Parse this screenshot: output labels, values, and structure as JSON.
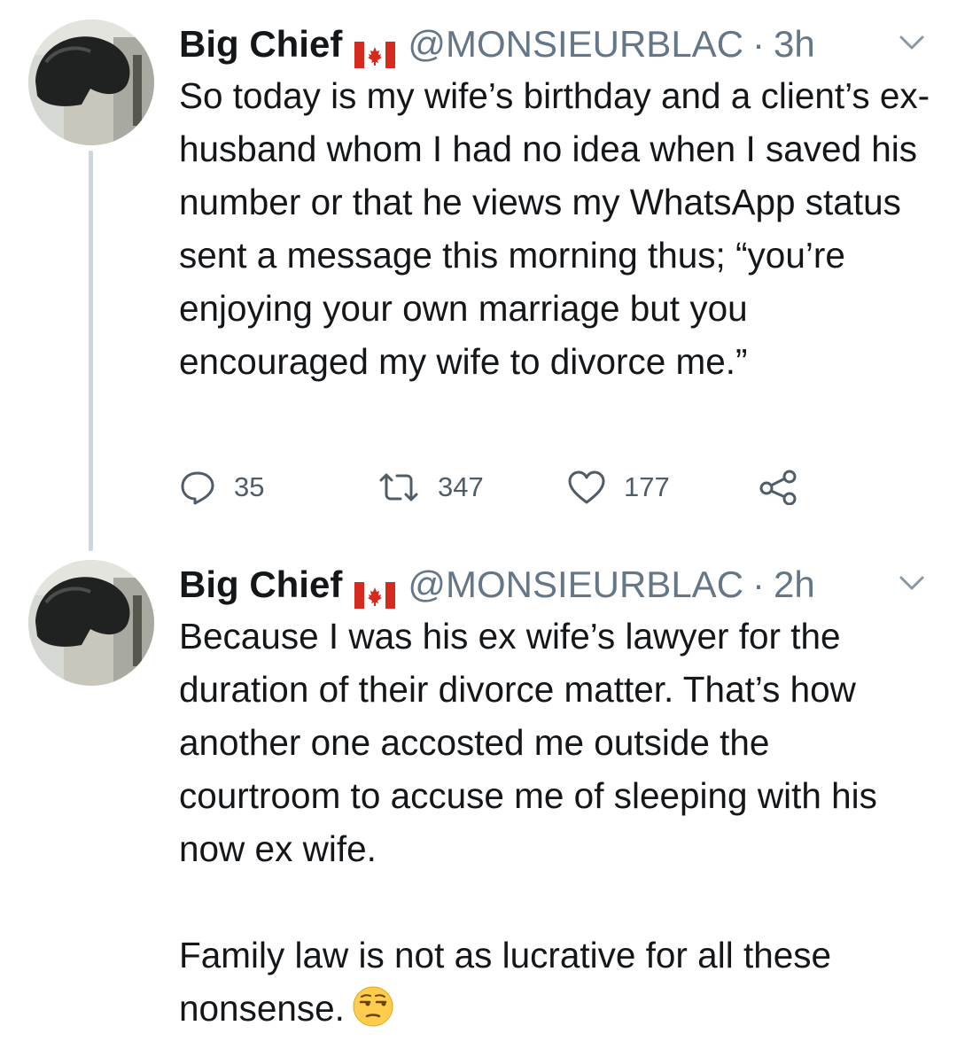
{
  "tweets": [
    {
      "name": "Big Chief",
      "handle": "@MONSIEURBLAC",
      "separator": "·",
      "time": "3h",
      "text": "So today is my wife’s birthday and a client’s ex-husband whom I had no idea when I saved his number or that he views my WhatsApp status sent a message this morning thus; “you’re enjoying your own marriage but you encouraged my wife to divorce me.”",
      "replies": "35",
      "retweets": "347",
      "likes": "177"
    },
    {
      "name": "Big Chief",
      "handle": "@MONSIEURBLAC",
      "separator": "·",
      "time": "2h",
      "text": "Because I was his ex wife’s lawyer for the duration of their divorce matter. That’s how another one accosted me outside the courtroom to accuse me of sleeping with his now ex wife.\n\nFamily law is not as lucrative for all these nonsense.",
      "emoji": "unamused-face-emoji"
    }
  ],
  "icons": {
    "flag": "canada-flag-icon",
    "caret": "chevron-down-icon",
    "reply": "reply-bubble-icon",
    "retweet": "retweet-icon",
    "like": "heart-icon",
    "share": "share-icon"
  },
  "colors": {
    "text": "#14171a",
    "secondary": "#657786",
    "thread_line": "#cdd6dd",
    "flag_red": "#d52b1e"
  }
}
